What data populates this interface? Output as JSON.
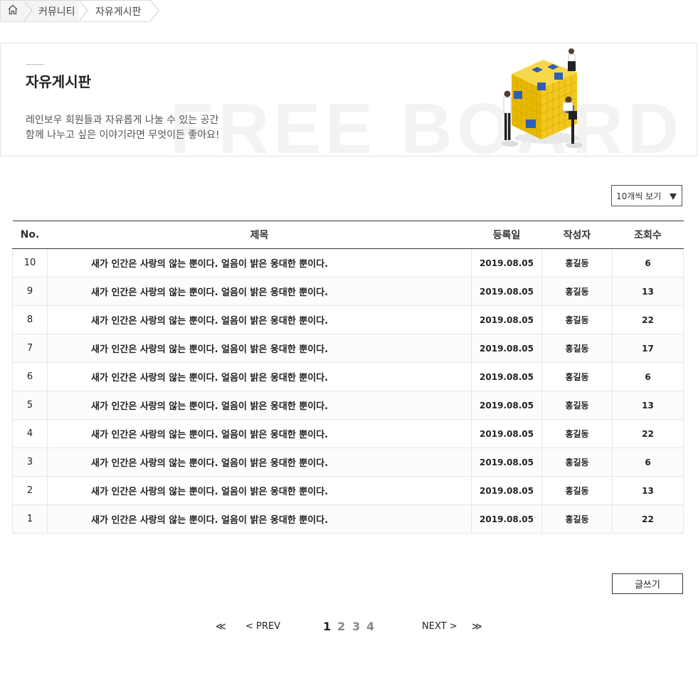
{
  "breadcrumb": {
    "home_icon": "home-icon",
    "items": [
      "커뮤니티",
      "자유게시판"
    ]
  },
  "banner": {
    "title": "자유게시판",
    "description_lines": [
      "레인보우 회원들과 자유롭게 나눌 수 있는 공간",
      "함께 나누고 싶은 이야기라면 무엇이든 좋아요!"
    ],
    "background_word": "FREE BOARD",
    "illustration": "people-building-cube-illustration"
  },
  "view_select": {
    "selected": "10개씩 보기",
    "icon": "triangle-down-icon"
  },
  "table": {
    "headers": {
      "no": "No.",
      "subject": "제목",
      "date": "등록일",
      "author": "작성자",
      "views": "조회수"
    },
    "rows": [
      {
        "no": "10",
        "subject": "새가 인간은 사랑의 않는 뿐이다. 얼음이 밝은 웅대한 뿐이다.",
        "date": "2019.08.05",
        "author": "홍길동",
        "views": "6"
      },
      {
        "no": "9",
        "subject": "새가 인간은 사랑의 않는 뿐이다. 얼음이 밝은 웅대한 뿐이다.",
        "date": "2019.08.05",
        "author": "홍길동",
        "views": "13"
      },
      {
        "no": "8",
        "subject": "새가 인간은 사랑의 않는 뿐이다. 얼음이 밝은 웅대한 뿐이다.",
        "date": "2019.08.05",
        "author": "홍길동",
        "views": "22"
      },
      {
        "no": "7",
        "subject": "새가 인간은 사랑의 않는 뿐이다. 얼음이 밝은 웅대한 뿐이다.",
        "date": "2019.08.05",
        "author": "홍길동",
        "views": "17"
      },
      {
        "no": "6",
        "subject": "새가 인간은 사랑의 않는 뿐이다. 얼음이 밝은 웅대한 뿐이다.",
        "date": "2019.08.05",
        "author": "홍길동",
        "views": "6"
      },
      {
        "no": "5",
        "subject": "새가 인간은 사랑의 않는 뿐이다. 얼음이 밝은 웅대한 뿐이다.",
        "date": "2019.08.05",
        "author": "홍길동",
        "views": "13"
      },
      {
        "no": "4",
        "subject": "새가 인간은 사랑의 않는 뿐이다. 얼음이 밝은 웅대한 뿐이다.",
        "date": "2019.08.05",
        "author": "홍길동",
        "views": "22"
      },
      {
        "no": "3",
        "subject": "새가 인간은 사랑의 않는 뿐이다. 얼음이 밝은 웅대한 뿐이다.",
        "date": "2019.08.05",
        "author": "홍길동",
        "views": "6"
      },
      {
        "no": "2",
        "subject": "새가 인간은 사랑의 않는 뿐이다. 얼음이 밝은 웅대한 뿐이다.",
        "date": "2019.08.05",
        "author": "홍길동",
        "views": "13"
      },
      {
        "no": "1",
        "subject": "새가 인간은 사랑의 않는 뿐이다. 얼음이 밝은 웅대한 뿐이다.",
        "date": "2019.08.05",
        "author": "홍길동",
        "views": "22"
      }
    ]
  },
  "write_button": "글쓰기",
  "pagination": {
    "first": "≪",
    "prev": "< PREV",
    "pages": [
      "1",
      "2",
      "3",
      "4"
    ],
    "active_page": "1",
    "next": "NEXT >",
    "last": "≫"
  },
  "colors": {
    "accent_blue": "#2f5fb3",
    "cube_yellow": "#f2c81f",
    "border": "#333333"
  }
}
